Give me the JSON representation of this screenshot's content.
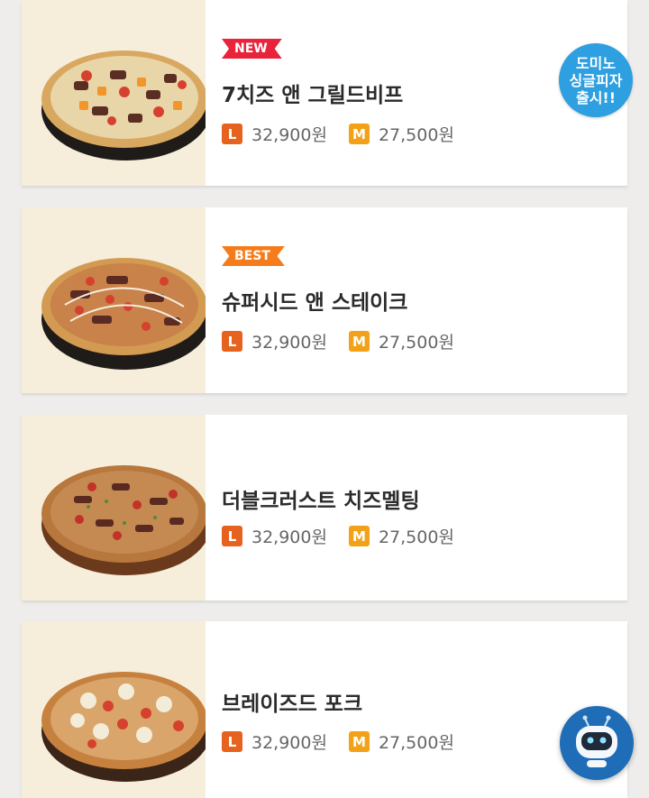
{
  "colors": {
    "background": "#eeedeb",
    "card": "#ffffff",
    "image_bg": "#f6eedb",
    "badge_new": "#e8233b",
    "badge_best": "#f47c1c",
    "size_l": "#e5631f",
    "size_m": "#f3a218",
    "promo": "#2e9fe0",
    "chatbot": "#1e6db6"
  },
  "menu": [
    {
      "badge": "NEW",
      "name": "7치즈 앤 그릴드비프",
      "size_l": "L",
      "price_l": "32,900원",
      "size_m": "M",
      "price_m": "27,500원"
    },
    {
      "badge": "BEST",
      "name": "슈퍼시드 앤 스테이크",
      "size_l": "L",
      "price_l": "32,900원",
      "size_m": "M",
      "price_m": "27,500원"
    },
    {
      "badge": "",
      "name": "더블크러스트 치즈멜팅",
      "size_l": "L",
      "price_l": "32,900원",
      "size_m": "M",
      "price_m": "27,500원"
    },
    {
      "badge": "",
      "name": "브레이즈드 포크",
      "size_l": "L",
      "price_l": "32,900원",
      "size_m": "M",
      "price_m": "27,500원"
    }
  ],
  "promo": {
    "line1": "도미노",
    "line2": "싱글피자",
    "line3": "출시!!"
  },
  "chatbot": {
    "icon": "robot-icon"
  }
}
